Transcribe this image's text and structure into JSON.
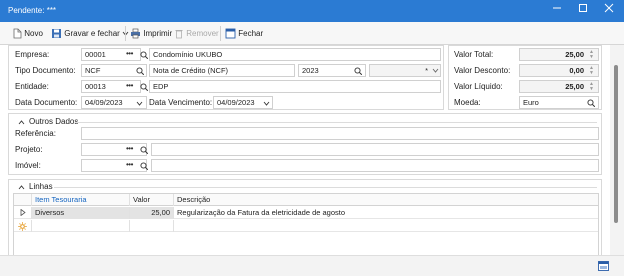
{
  "window": {
    "title": "Pendente: ***"
  },
  "toolbar": {
    "novo": "Novo",
    "gravar": "Gravar e fechar",
    "imprimir": "Imprimir",
    "remover": "Remover",
    "fechar": "Fechar"
  },
  "form": {
    "empresa_label": "Empresa:",
    "empresa_code": "00001",
    "empresa_name": "Condomínio UKUBO",
    "tipo_label": "Tipo Documento:",
    "tipo_code": "NCF",
    "tipo_name": "Nota de Crédito (NCF)",
    "ano": "2023",
    "serie": "*",
    "entidade_label": "Entidade:",
    "entidade_code": "00013",
    "entidade_name": "EDP",
    "data_doc_label": "Data Documento:",
    "data_doc": "04/09/2023",
    "data_venc_label": "Data Vencimento:",
    "data_venc": "04/09/2023"
  },
  "totals": {
    "total_label": "Valor Total:",
    "total": "25,00",
    "desconto_label": "Valor Desconto:",
    "desconto": "0,00",
    "liquido_label": "Valor Líquido:",
    "liquido": "25,00",
    "moeda_label": "Moeda:",
    "moeda": "Euro"
  },
  "outros": {
    "title": "Outros Dados",
    "referencia_label": "Referência:",
    "projeto_label": "Projeto:",
    "imovel_label": "Imóvel:"
  },
  "linhas": {
    "title": "Linhas",
    "columns": [
      "Item Tesouraria",
      "Valor",
      "Descrição"
    ],
    "rows": [
      {
        "item": "Diversos",
        "valor": "25,00",
        "descricao": "Regularização da Fatura da eletricidade de agosto"
      }
    ]
  },
  "colors": {
    "titlebar": "#2b7bd3",
    "accent": "#1565c0"
  }
}
